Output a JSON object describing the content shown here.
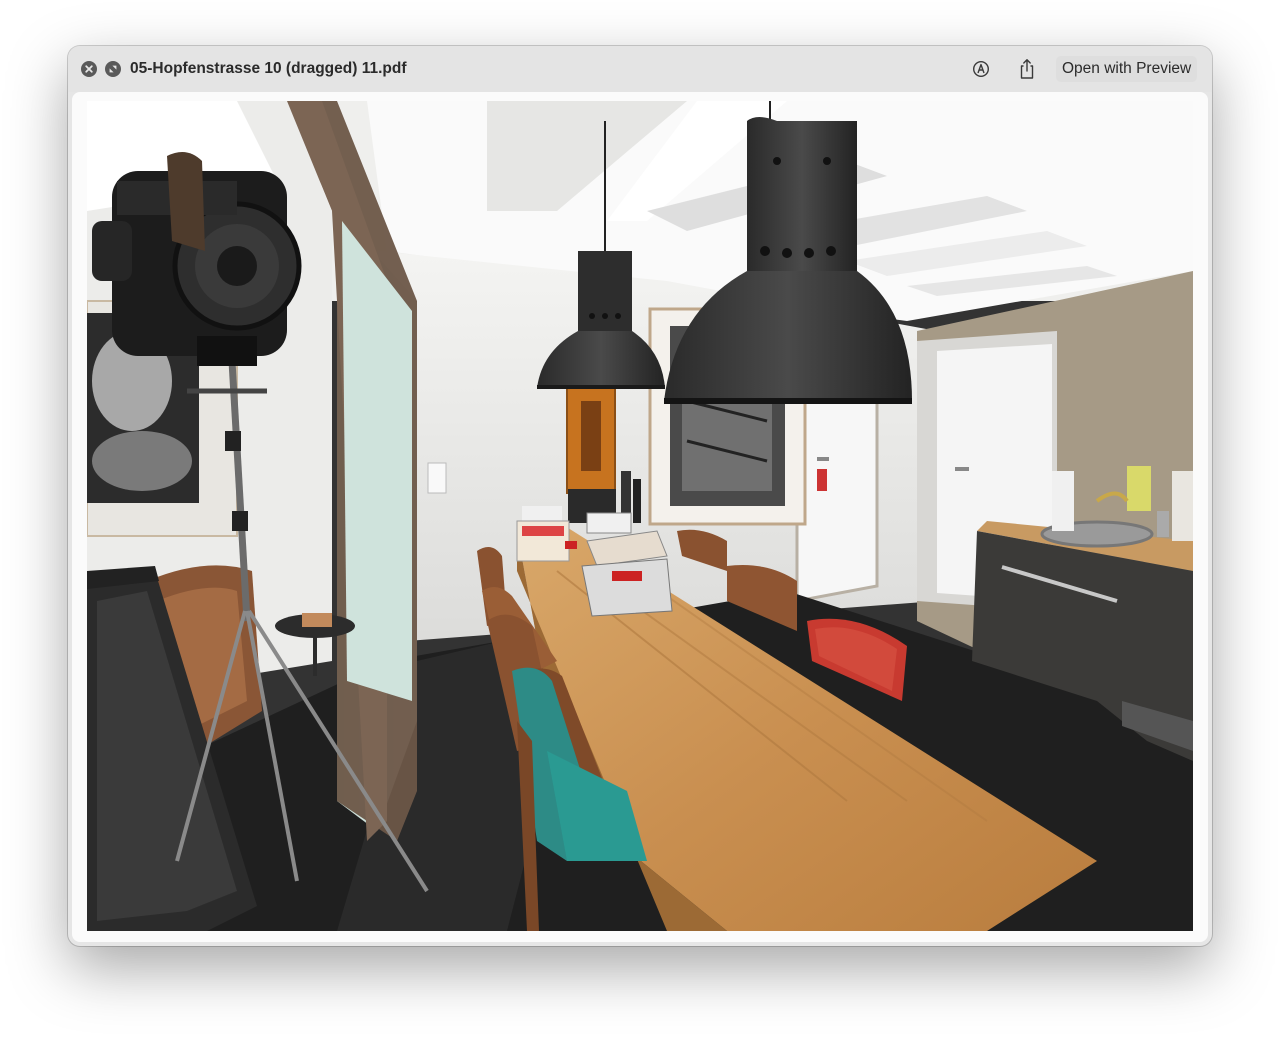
{
  "window": {
    "title": "05-Hopfenstrasse 10 (dragged) 11.pdf",
    "open_button_label": "Open with Preview",
    "controls": {
      "close_icon": "close-icon",
      "fullscreen_icon": "fullscreen-icon"
    },
    "toolbar_icons": [
      "markup-icon",
      "share-icon"
    ]
  },
  "document": {
    "content": "photo of a meeting room with a long wooden table, chairs, two large black pendant lamps, a studio spotlight on a tripod, framed pictures and a small kitchen counter"
  },
  "colors": {
    "titlebar": "#e4e4e4",
    "control": "#5a5a5a",
    "title_text": "#2b2b2b"
  }
}
